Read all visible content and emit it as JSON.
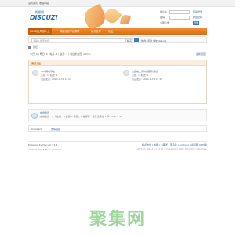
{
  "topbar": {
    "left": "设为首页",
    "mid": "收藏本站"
  },
  "logo": {
    "cn": "资源网",
    "en": "DISCUZ!"
  },
  "login": {
    "user_label": "用户名",
    "pass_label": "密码",
    "auto_label": "自动登录",
    "forgot": "找回密码",
    "register": "立即注册",
    "login_button": "登录"
  },
  "nav": {
    "items": [
      "XXX网址导航大全",
      "网站优化平台导航",
      "站长世界",
      "论坛"
    ]
  },
  "search": {
    "placeholder": "请输入搜索内容",
    "type": "帖子",
    "hot": "热搜: 活动 交友 discuz"
  },
  "breadcrumb": {
    "path": "论坛"
  },
  "stats": {
    "left": "今日: 0 | 昨日: 0 | 帖子: 2 | 会员: 1 | 欢迎新会员: admin",
    "right": "最新回复"
  },
  "forum_box": {
    "header": "测试分区",
    "forums": [
      {
        "name": "XXX网址导航",
        "count": "主题: 1, 帖数: 1",
        "last": "最后发表: 2024-1-31 12:03"
      },
      {
        "name": "主题帖上传并用服务测试",
        "count": "主题: 1, 帖数: 1",
        "last": "最后发表: 2024-1-31 12:36"
      }
    ]
  },
  "online": {
    "title": "在线会员",
    "text": "在线会员 - 1 人在线 - 0 会员(0 隐身), 1 位游客 - 最高记录是 1 于 2024-1-31."
  },
  "links": {
    "label": "Company",
    "value": "友情链接"
  },
  "footer": {
    "powered": "Powered by Discuz! X3.4",
    "copyright": "© 2001-2017 Tencent Cloud.",
    "links": "站点统计 | 举报 | 小黑屋 | 手机版 | Archiver | 资源网 (ICP备)",
    "gmt": "GMT+8, 2024-1-31 12:36 , Processed in 0.013 second(s), 2 queries ."
  },
  "watermark": "聚集网"
}
